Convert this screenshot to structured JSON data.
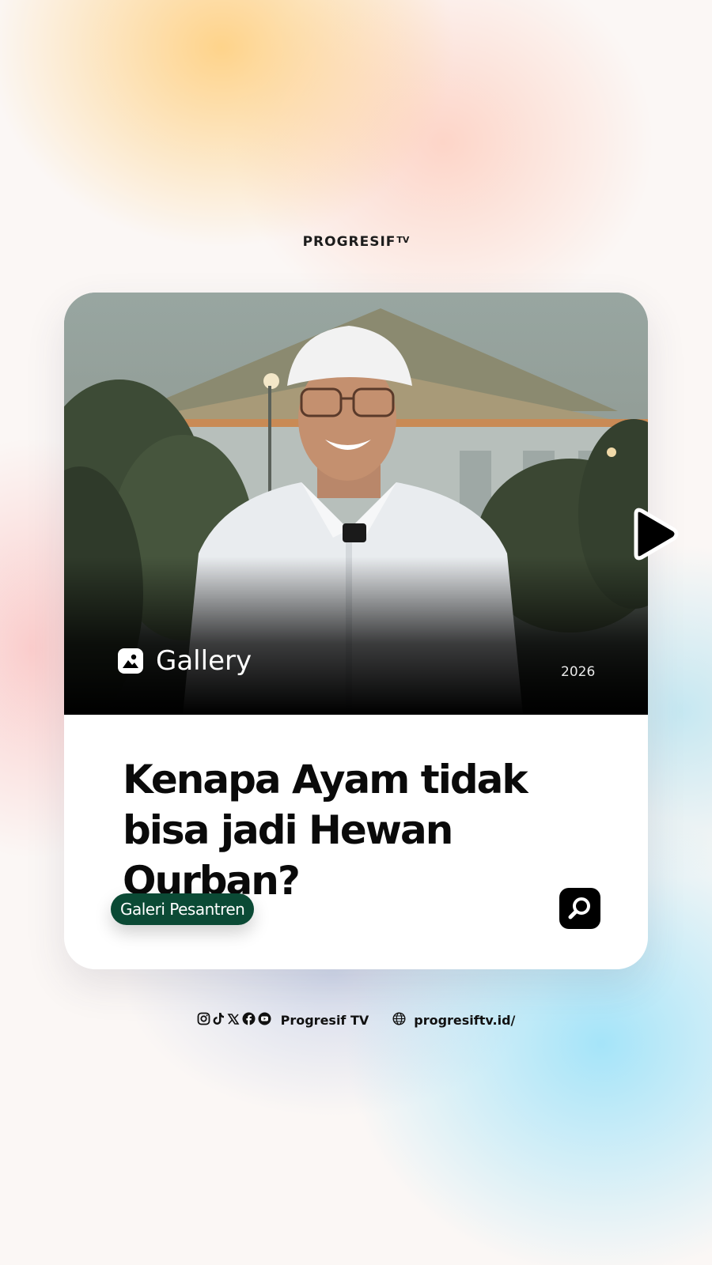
{
  "brand": {
    "name": "PROGRESIF",
    "suffix": "TV"
  },
  "card": {
    "media_type": "Gallery",
    "year": "2026",
    "headline_line1": "Kenapa Ayam tidak",
    "headline_line2": "bisa jadi Hewan Qurban?",
    "tag": "Galeri Pesantren",
    "tag_color": "#0b4a35"
  },
  "footer": {
    "social_icons": [
      "instagram-icon",
      "tiktok-icon",
      "x-icon",
      "facebook-icon",
      "youtube-icon"
    ],
    "handle": "Progresif TV",
    "website": "progresiftv.id/"
  }
}
